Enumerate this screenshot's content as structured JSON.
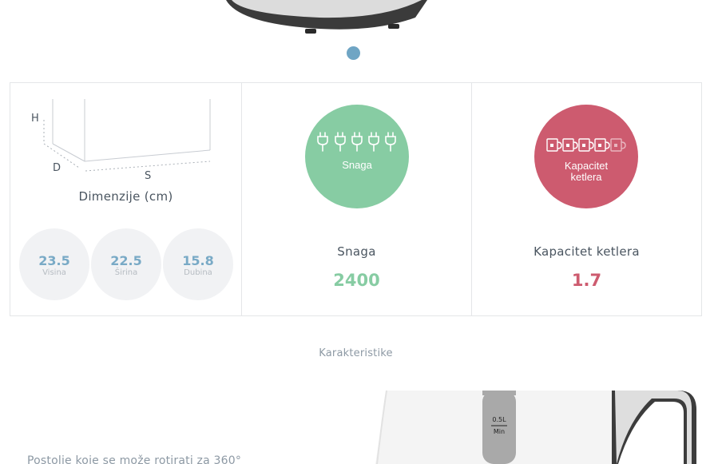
{
  "carousel": {
    "active_index": 0,
    "dot_color": "#6fa5c4"
  },
  "dimensions": {
    "axis_labels": {
      "h": "H",
      "d": "D",
      "s": "S"
    },
    "title": "Dimenzije (cm)",
    "items": [
      {
        "value": "23.5",
        "label": "Visina"
      },
      {
        "value": "22.5",
        "label": "Širina"
      },
      {
        "value": "15.8",
        "label": "Dubina"
      }
    ]
  },
  "power": {
    "badge_text": "Snaga",
    "badge_color": "#87cca3",
    "badge_icon": "plug-icon",
    "name": "Snaga",
    "value": "2400"
  },
  "capacity": {
    "badge_line1": "Kapacitet",
    "badge_line2": "ketlera",
    "badge_color": "#cd5b6f",
    "badge_icon": "cup-icon",
    "name": "Kapacitet ketlera",
    "value": "1.7"
  },
  "section": {
    "heading": "Karakteristike"
  },
  "feature": {
    "text": "Postolje koje se može rotirati za 360°",
    "gauge_top": "0.5L",
    "gauge_bottom": "Min"
  }
}
